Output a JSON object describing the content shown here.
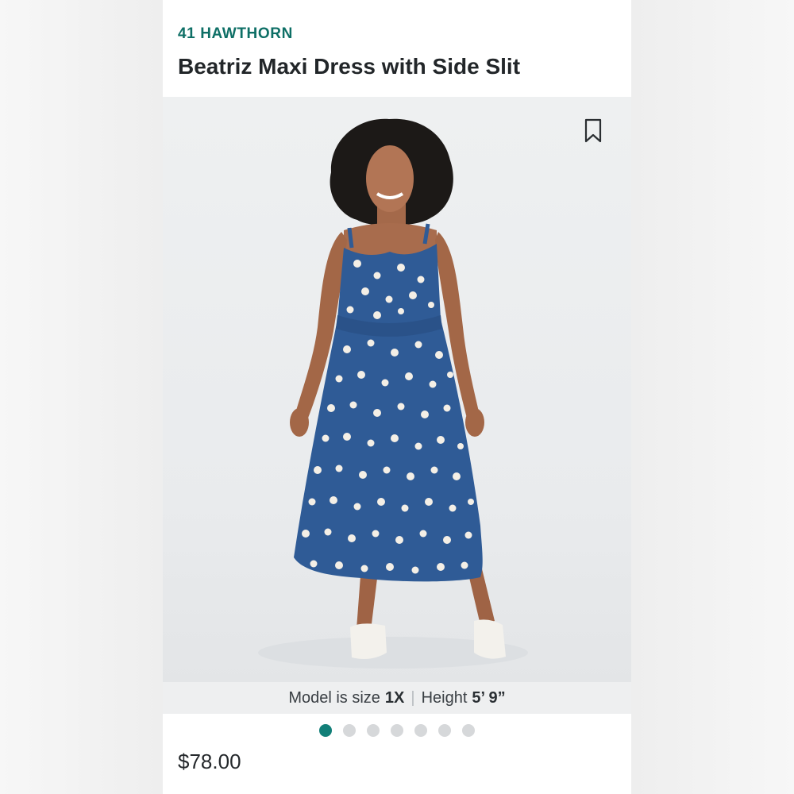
{
  "product": {
    "brand": "41 HAWTHORN",
    "title": "Beatriz Maxi Dress with Side Slit",
    "price": "$78.00"
  },
  "model_info": {
    "size_label": "Model is size",
    "size_value": "1X",
    "separator": "|",
    "height_label": "Height",
    "height_value": "5’ 9”"
  },
  "carousel": {
    "count": 7,
    "active_index": 0
  },
  "icons": {
    "bookmark": "bookmark-icon"
  },
  "colors": {
    "brand": "#0e6f66",
    "active_dot": "#127f78",
    "inactive_dot": "#d6d8da",
    "dress": "#2f5b96"
  }
}
